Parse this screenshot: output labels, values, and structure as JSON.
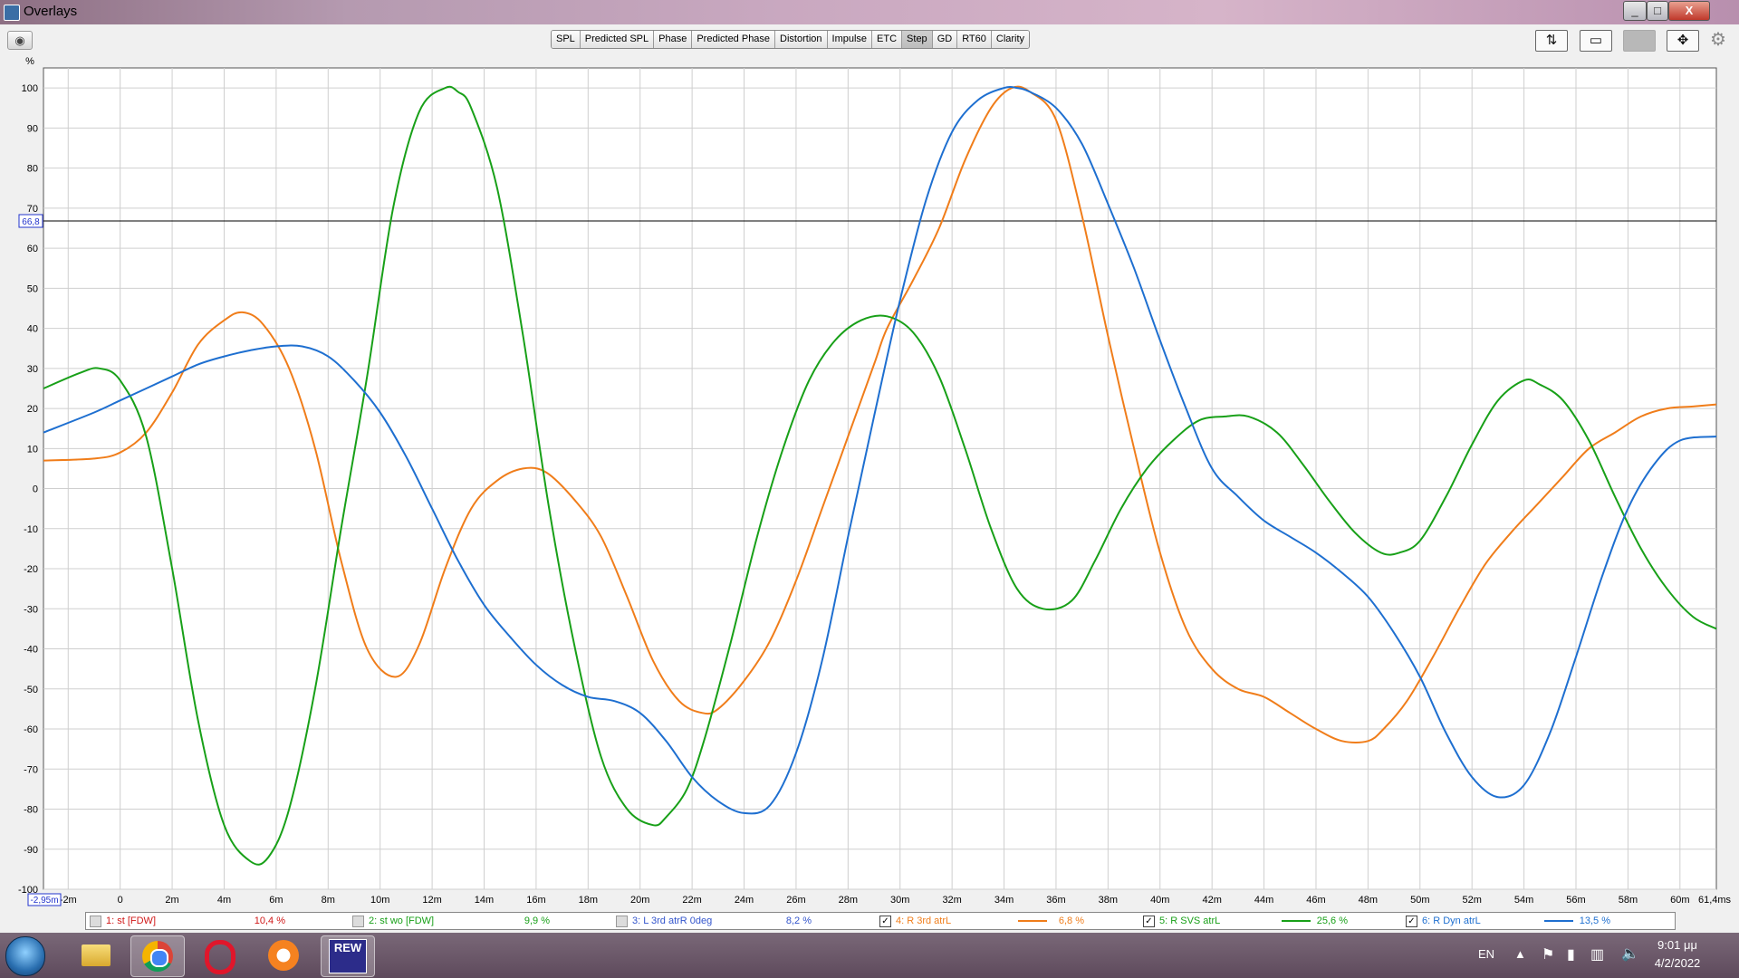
{
  "window": {
    "title": "Overlays",
    "controls": [
      "_",
      "□",
      "X"
    ]
  },
  "toolbar": {
    "tabs": [
      "SPL",
      "Predicted SPL",
      "Phase",
      "Predicted Phase",
      "Distortion",
      "Impulse",
      "ETC",
      "Step",
      "GD",
      "RT60",
      "Clarity"
    ],
    "active_tab": "Step",
    "tools": [
      "trace-arith-icon",
      "window-fit-icon",
      "blank-tool-icon",
      "axis-expand-icon",
      "gear-icon"
    ]
  },
  "chart_data": {
    "type": "line",
    "ylabel": "%",
    "ylim": [
      -100,
      105
    ],
    "xlim": [
      -2.95,
      61.4
    ],
    "y_ticks": [
      "100",
      "90",
      "80",
      "70",
      "60",
      "50",
      "40",
      "30",
      "20",
      "10",
      "0",
      "-10",
      "-20",
      "-30",
      "-40",
      "-50",
      "-60",
      "-70",
      "-80",
      "-90",
      "-100"
    ],
    "x_ticks": [
      "-2m",
      "0",
      "2m",
      "4m",
      "6m",
      "8m",
      "10m",
      "12m",
      "14m",
      "16m",
      "18m",
      "20m",
      "22m",
      "24m",
      "26m",
      "28m",
      "30m",
      "32m",
      "34m",
      "36m",
      "38m",
      "40m",
      "42m",
      "44m",
      "46m",
      "48m",
      "50m",
      "52m",
      "54m",
      "56m",
      "58m",
      "60m"
    ],
    "x_start_label": "-2,95m",
    "x_end_label": "61,4ms",
    "cursor_y": 66.8,
    "cursor_label": "66,8",
    "grid": true,
    "series": [
      {
        "name": "4: R 3rd atrL",
        "color": "#f07d1a",
        "x": [
          -2.95,
          -1,
          0,
          1,
          2,
          3,
          4,
          4.7,
          5.5,
          6.5,
          7.5,
          8.5,
          9.5,
          10.6,
          11.5,
          12.5,
          13.5,
          14.5,
          15.5,
          16.4,
          17.5,
          18.5,
          19.5,
          20.5,
          21.5,
          22.4,
          23,
          24,
          25,
          26,
          27,
          28,
          29,
          29.5,
          30.5,
          31.5,
          32.5,
          33.5,
          34.3,
          35,
          36,
          37,
          38,
          39,
          40,
          41,
          42,
          43,
          44,
          45,
          46,
          47,
          48,
          48.6,
          49.5,
          50.5,
          51.5,
          52.5,
          53.5,
          54.5,
          55.5,
          56.5,
          57.5,
          58.5,
          59.5,
          60.5,
          61.4
        ],
        "y": [
          7,
          7.5,
          9,
          14,
          24,
          36,
          42,
          44,
          41,
          30,
          10,
          -18,
          -40,
          -47,
          -39,
          -20,
          -5,
          2,
          5,
          4,
          -3,
          -12,
          -27,
          -43,
          -53,
          -56,
          -55,
          -48,
          -38,
          -23,
          -5,
          13,
          31,
          40,
          52,
          65,
          82,
          95,
          100,
          99,
          92,
          68,
          38,
          10,
          -16,
          -35,
          -45,
          -50,
          -52,
          -56,
          -60,
          -63,
          -63,
          -60,
          -53,
          -42,
          -30,
          -19,
          -11,
          -4,
          3,
          10,
          14,
          18,
          20,
          20.5,
          21
        ]
      },
      {
        "name": "5: R SVS atrL",
        "color": "#18a018",
        "x": [
          -2.95,
          -1.5,
          -0.8,
          0,
          1,
          2,
          3,
          4,
          5,
          5.7,
          6.5,
          7.5,
          8.5,
          9.5,
          10.5,
          11.5,
          12.5,
          13,
          13.5,
          14.5,
          15.5,
          16.5,
          17.5,
          18.5,
          19.5,
          20.5,
          21,
          21.8,
          22.5,
          23.5,
          24.5,
          25.5,
          26.5,
          27.5,
          28.5,
          29.5,
          30.5,
          31.5,
          32.5,
          33.5,
          34.5,
          35.5,
          36.6,
          37.5,
          38.5,
          39.5,
          40.5,
          41.5,
          42.5,
          43.4,
          44.5,
          45.5,
          46.5,
          47.5,
          48.5,
          49.2,
          50,
          51,
          52,
          53,
          54,
          54.6,
          55.5,
          56.5,
          57.5,
          58.5,
          59.5,
          60.5,
          61.4
        ],
        "y": [
          25,
          29,
          30,
          27,
          13,
          -20,
          -58,
          -84,
          -93,
          -92,
          -80,
          -50,
          -10,
          28,
          70,
          94,
          100,
          99,
          95,
          75,
          38,
          -5,
          -40,
          -67,
          -80,
          -84,
          -82,
          -75,
          -62,
          -38,
          -12,
          10,
          27,
          37,
          42,
          43,
          39,
          28,
          10,
          -10,
          -25,
          -30,
          -28,
          -18,
          -5,
          5,
          12,
          17,
          18,
          18,
          14,
          6,
          -3,
          -11,
          -16,
          -16,
          -13,
          -2,
          11,
          22,
          27,
          26,
          22,
          12,
          -2,
          -15,
          -25,
          -32,
          -35
        ]
      },
      {
        "name": "6: R Dyn atrL",
        "color": "#1e6fd0",
        "x": [
          -2.95,
          -1,
          0,
          1,
          2,
          3,
          4,
          5,
          6,
          7,
          8,
          9,
          10,
          11,
          12,
          13,
          14,
          15,
          16,
          17,
          18,
          19,
          20,
          21,
          22,
          23,
          24,
          25,
          26,
          27,
          28,
          29,
          30,
          31,
          32,
          33,
          34,
          34.5,
          35,
          36,
          37,
          38,
          39,
          40,
          41,
          42,
          43,
          44,
          45,
          46,
          47,
          48,
          49,
          50,
          51,
          52,
          53,
          54,
          55,
          56,
          57,
          58,
          59,
          60,
          61.4
        ],
        "y": [
          14,
          19,
          22,
          25,
          28,
          31,
          33,
          34.5,
          35.5,
          35.5,
          33,
          27,
          19,
          8,
          -5,
          -18,
          -29,
          -37,
          -44,
          -49,
          -52,
          -53,
          -56,
          -63,
          -72,
          -78,
          -81,
          -79,
          -66,
          -43,
          -12,
          18,
          47,
          72,
          89,
          97,
          100,
          100,
          99,
          95,
          86,
          71,
          55,
          37,
          20,
          5,
          -2,
          -8,
          -12,
          -16,
          -21,
          -27,
          -36,
          -47,
          -61,
          -72,
          -77,
          -74,
          -61,
          -42,
          -22,
          -5,
          6,
          12,
          13
        ]
      }
    ]
  },
  "legend": [
    {
      "label": "1: st [FDW]",
      "checked": false,
      "color": "#d01818",
      "percent": "10,4 %"
    },
    {
      "label": "2: st wo [FDW]",
      "checked": false,
      "color": "#18a018",
      "percent": "9,9 %"
    },
    {
      "label": "3: L 3rd atrR 0deg",
      "checked": false,
      "color": "#3355cc",
      "percent": "8,2 %"
    },
    {
      "label": "4: R 3rd atrL",
      "checked": true,
      "color": "#f07d1a",
      "percent": "6,8 %"
    },
    {
      "label": "5: R SVS atrL",
      "checked": true,
      "color": "#18a018",
      "percent": "25,6 %"
    },
    {
      "label": "6: R Dyn atrL",
      "checked": true,
      "color": "#1e6fd0",
      "percent": "13,5 %"
    }
  ],
  "taskbar": {
    "apps": [
      "windows-start-icon",
      "explorer-icon",
      "chrome-icon",
      "opera-icon",
      "avast-browser-icon",
      "rew-icon"
    ],
    "rew_label": "REW",
    "lang": "EN",
    "time": "9:01 μμ",
    "date": "4/2/2022"
  }
}
